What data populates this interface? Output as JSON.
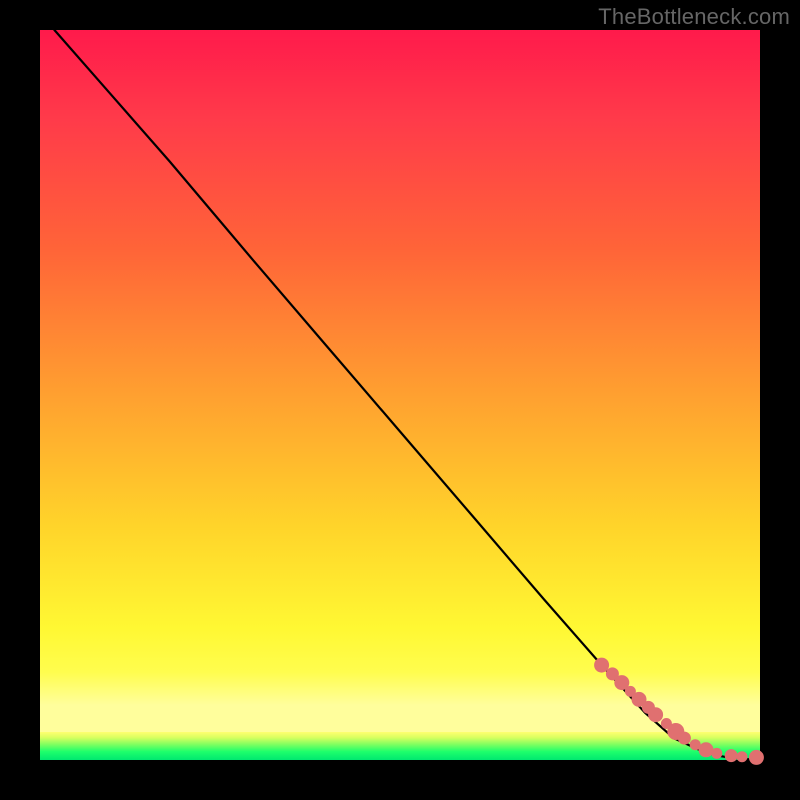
{
  "watermark": "TheBottleneck.com",
  "chart_data": {
    "type": "line",
    "title": "",
    "xlabel": "",
    "ylabel": "",
    "xlim": [
      0,
      100
    ],
    "ylim": [
      0,
      100
    ],
    "series": [
      {
        "name": "curve",
        "x": [
          2,
          10,
          18,
          24,
          30,
          40,
          50,
          60,
          70,
          78,
          84,
          88,
          92,
          94,
          96,
          98,
          100
        ],
        "y": [
          100,
          91,
          82,
          75,
          68,
          56.5,
          45,
          33.5,
          22,
          13,
          6.5,
          3,
          1.2,
          0.6,
          0.3,
          0.12,
          0.05
        ]
      }
    ],
    "scatter": {
      "name": "dots",
      "x": [
        78,
        79.5,
        80.8,
        82,
        83.2,
        84.5,
        85.5,
        87,
        88.3,
        89.5,
        91,
        92.5,
        94,
        96,
        97.5,
        99.5
      ],
      "y": [
        13,
        11.8,
        10.6,
        9.4,
        8.3,
        7.2,
        6.2,
        5.0,
        3.9,
        3.0,
        2.1,
        1.4,
        0.9,
        0.6,
        0.45,
        0.35
      ],
      "r": [
        7,
        6,
        7,
        5,
        7,
        6,
        7,
        5,
        8,
        6,
        5,
        7,
        5,
        6,
        5,
        7
      ]
    },
    "gradient_stops": [
      {
        "pos": 0.0,
        "color": "#ff1a4b"
      },
      {
        "pos": 0.5,
        "color": "#ffa030"
      },
      {
        "pos": 0.82,
        "color": "#fff833"
      },
      {
        "pos": 0.96,
        "color": "#d8ff60"
      },
      {
        "pos": 1.0,
        "color": "#00e870"
      }
    ]
  }
}
